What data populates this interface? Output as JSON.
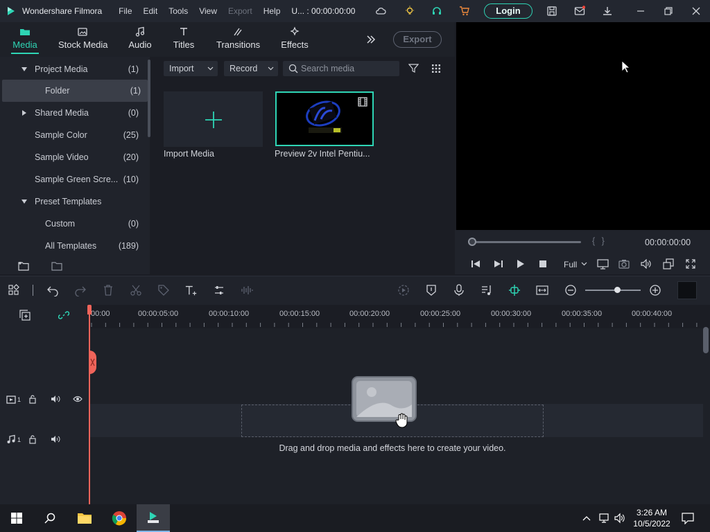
{
  "titlebar": {
    "app_name": "Wondershare Filmora",
    "menu": [
      "File",
      "Edit",
      "Tools",
      "View",
      "Export",
      "Help"
    ],
    "project_time": "U... : 00:00:00:00",
    "login_label": "Login"
  },
  "media_tabs": [
    {
      "label": "Media",
      "icon": "media-folder-icon",
      "active": true
    },
    {
      "label": "Stock Media",
      "icon": "stock-media-icon",
      "active": false
    },
    {
      "label": "Audio",
      "icon": "audio-note-icon",
      "active": false
    },
    {
      "label": "Titles",
      "icon": "titles-t-icon",
      "active": false
    },
    {
      "label": "Transitions",
      "icon": "transitions-icon",
      "active": false
    },
    {
      "label": "Effects",
      "icon": "effects-icon",
      "active": false
    }
  ],
  "export_label": "Export",
  "tree": [
    {
      "label": "Project Media",
      "count": "(1)",
      "expanded": true
    },
    {
      "label": "Folder",
      "count": "(1)",
      "selected": true
    },
    {
      "label": "Shared Media",
      "count": "(0)",
      "expanded": false
    },
    {
      "label": "Sample Color",
      "count": "(25)"
    },
    {
      "label": "Sample Video",
      "count": "(20)"
    },
    {
      "label": "Sample Green Scre...",
      "count": "(10)"
    },
    {
      "label": "Preset Templates",
      "count": "",
      "expanded": true
    },
    {
      "label": "Custom",
      "count": "(0)"
    },
    {
      "label": "All Templates",
      "count": "(189)"
    }
  ],
  "media_toolbar": {
    "import_label": "Import",
    "record_label": "Record",
    "search_placeholder": "Search media"
  },
  "media_items": {
    "import_label": "Import Media",
    "clip_label": "Preview 2v Intel Pentiu..."
  },
  "preview": {
    "braces": "{    }",
    "timecode": "00:00:00:00",
    "quality": "Full"
  },
  "ruler_labels": [
    "00:00",
    "00:00:05:00",
    "00:00:10:00",
    "00:00:15:00",
    "00:00:20:00",
    "00:00:25:00",
    "00:00:30:00",
    "00:00:35:00",
    "00:00:40:00"
  ],
  "tracks": {
    "video_num": "1",
    "audio_num": "1"
  },
  "drop_text": "Drag and drop media and effects here to create your video.",
  "taskbar": {
    "time": "3:26 AM",
    "date": "10/5/2022"
  },
  "colors": {
    "accent": "#2ed5b5",
    "playhead": "#f0645a",
    "background": "#1b1d24"
  }
}
